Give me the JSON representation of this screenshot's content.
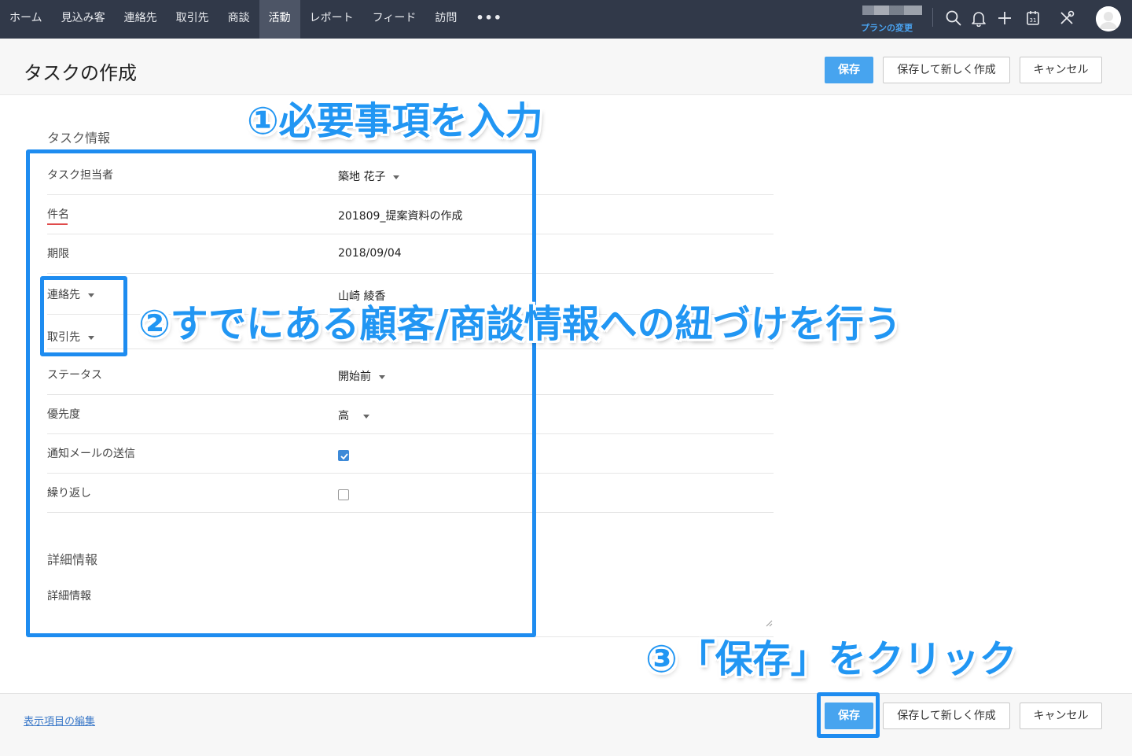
{
  "nav": {
    "items": [
      "ホーム",
      "見込み客",
      "連絡先",
      "取引先",
      "商談",
      "活動",
      "レポート",
      "フィード",
      "訪問"
    ],
    "active_index": 5,
    "more": "•••",
    "plan_link": "プランの変更"
  },
  "topbar_icons": [
    "search-icon",
    "bell-icon",
    "plus-icon",
    "calendar-icon",
    "tools-icon",
    "avatar"
  ],
  "header": {
    "title": "タスクの作成",
    "save_label": "保存",
    "save_new_label": "保存して新しく作成",
    "cancel_label": "キャンセル"
  },
  "form": {
    "section_task": "タスク情報",
    "owner": {
      "label": "タスク担当者",
      "value": "築地 花子"
    },
    "subject": {
      "label": "件名",
      "value": "201809_提案資料の作成"
    },
    "due": {
      "label": "期限",
      "value": "2018/09/04"
    },
    "contact": {
      "label": "連絡先",
      "value": "山崎 綾香"
    },
    "account": {
      "label": "取引先",
      "value": ""
    },
    "status": {
      "label": "ステータス",
      "value": "開始前"
    },
    "priority": {
      "label": "優先度",
      "value": "高"
    },
    "notify": {
      "label": "通知メールの送信",
      "checked": true
    },
    "repeat": {
      "label": "繰り返し",
      "checked": false
    },
    "section_detail": "詳細情報",
    "detail": {
      "label": "詳細情報",
      "value": ""
    }
  },
  "footer": {
    "edit_fields_link": "表示項目の編集",
    "save_label": "保存",
    "save_new_label": "保存して新しく作成",
    "cancel_label": "キャンセル"
  },
  "annotations": {
    "step1": "①必要事項を入力",
    "step2": "②すでにある顧客/商談情報への紐づけを行う",
    "step3": "③「保存」をクリック",
    "accent_color": "#1e8cf0"
  }
}
